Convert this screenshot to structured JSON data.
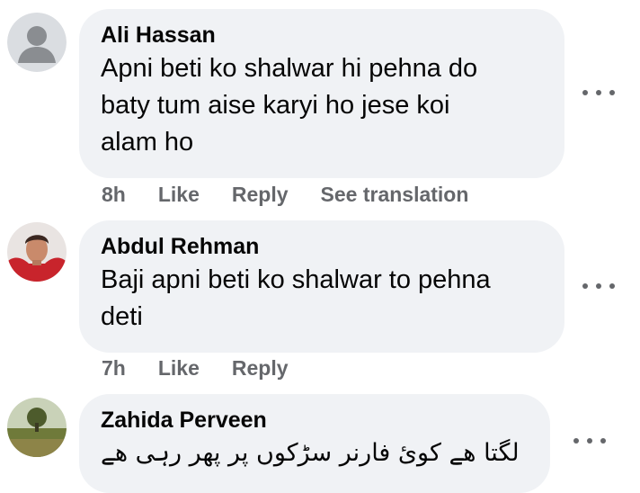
{
  "comments": [
    {
      "author": "Ali Hassan",
      "text_lines": [
        "Apni beti ko shalwar hi pehna do",
        "baty tum aise karyi ho jese koi",
        "alam ho"
      ],
      "time": "8h",
      "like": "Like",
      "reply": "Reply",
      "translate": "See translation",
      "avatar": "default-profile-icon"
    },
    {
      "author": "Abdul Rehman",
      "text_lines": [
        "Baji apni beti ko shalwar to pehna",
        "deti"
      ],
      "time": "7h",
      "like": "Like",
      "reply": "Reply",
      "avatar": "profile-photo-red"
    },
    {
      "author": "Zahida Perveen",
      "text": "لگتا ھے کوئ فارنر سڑکوں پر پھر رہی ھے",
      "avatar": "profile-photo-landscape"
    }
  ],
  "more_icon": "more-options-icon",
  "colors": {
    "bubble": "#f0f2f5",
    "meta_text": "#65676b",
    "text": "#050505"
  }
}
